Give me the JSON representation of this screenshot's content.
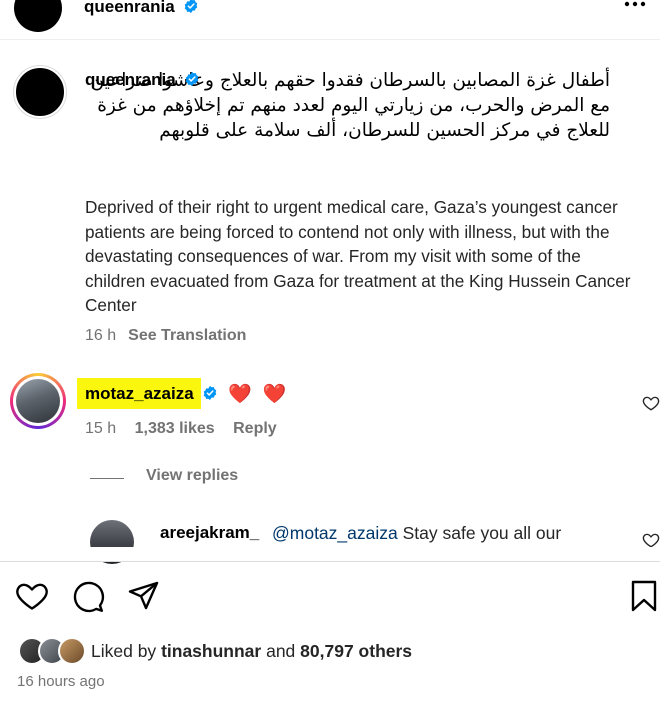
{
  "header": {
    "username": "queenrania"
  },
  "post": {
    "username": "queenrania",
    "caption_arabic": "أطفال غزة المصابين بالسرطان فقدوا حقهم بالعلاج وعاشوا صراعين مع المرض والحرب، من زيارتي اليوم لعدد منهم تم إخلاؤهم من غزة للعلاج في مركز الحسين للسرطان، ألف سلامة على قلوبهم",
    "caption_english": "Deprived of their right to urgent medical care, Gaza’s youngest cancer patients are being forced to contend not only with illness, but with the devastating consequences of war. From my visit with some of the children evacuated from Gaza for treatment at the King Hussein Cancer Center",
    "time": "16 h",
    "see_translation": "See Translation"
  },
  "comment": {
    "username": "motaz_azaiza",
    "text": "❤️ ❤️",
    "time": "15 h",
    "likes": "1,383 likes",
    "reply": "Reply"
  },
  "view_replies": "View replies",
  "reply": {
    "username": "areejakram_",
    "mention": "@motaz_azaiza",
    "text": "Stay safe you all our"
  },
  "likes": {
    "prefix": "Liked by",
    "user": "tinashunnar",
    "middle": "and",
    "count": "80,797 others"
  },
  "timestamp": "16 hours ago",
  "colors": {
    "verified": "#0095f6",
    "highlight": "#fbf60e",
    "muted_text": "#737373",
    "heart_red": "#e0245e"
  },
  "icons": [
    "verified-badge-icon",
    "more-options-icon",
    "heart-outline-icon",
    "comment-icon",
    "share-icon",
    "save-bookmark-icon"
  ]
}
